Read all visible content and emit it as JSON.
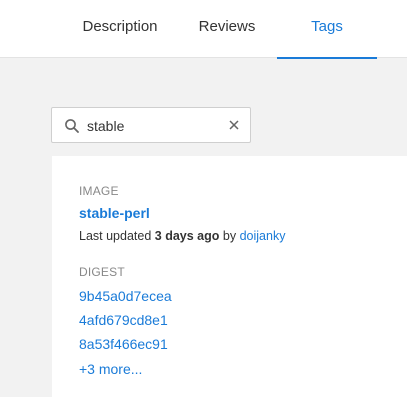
{
  "tabs": {
    "description": "Description",
    "reviews": "Reviews",
    "tags": "Tags",
    "active": "Tags"
  },
  "search": {
    "value": "stable",
    "icon": "search-icon",
    "clear_icon": "close-icon"
  },
  "tag_card": {
    "image_label": "IMAGE",
    "image_name": "stable-perl",
    "updated_prefix": "Last updated",
    "updated_time": "3 days ago",
    "updated_by": "by",
    "updated_user": "doijanky",
    "digest_label": "DIGEST",
    "digests": [
      "9b45a0d7ecea",
      "4afd679cd8e1",
      "8a53f466ec91"
    ],
    "more": "+3 more..."
  },
  "colors": {
    "accent": "#1a7bd8",
    "text": "#333333",
    "muted": "#888888",
    "background": "#f2f2f2"
  }
}
